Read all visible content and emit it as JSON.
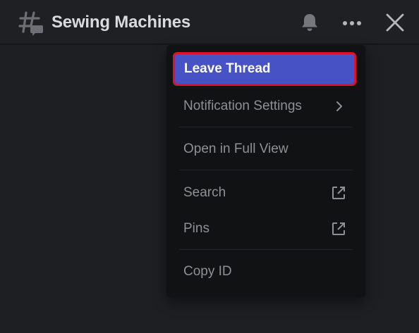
{
  "header": {
    "title": "Sewing Machines",
    "icons": {
      "thread": "thread-hash-icon",
      "bell": "bell-icon",
      "more": "more-dots-icon",
      "close": "close-icon"
    }
  },
  "menu": {
    "leave_thread": "Leave Thread",
    "notification_settings": "Notification Settings",
    "open_full_view": "Open in Full View",
    "search": "Search",
    "pins": "Pins",
    "copy_id": "Copy ID"
  },
  "colors": {
    "accent": "#4752c4",
    "focus_ring": "#e0102d",
    "menu_bg": "#111214",
    "header_bg": "#1f2023"
  }
}
